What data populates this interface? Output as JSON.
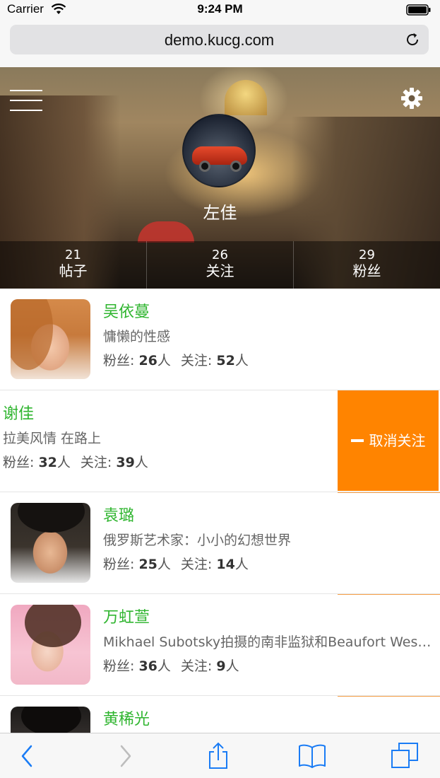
{
  "status_bar": {
    "carrier": "Carrier",
    "time": "9:24 PM"
  },
  "browser": {
    "url": "demo.kucg.com"
  },
  "profile": {
    "name": "左佳",
    "stats": [
      {
        "count": "21",
        "label": "帖子"
      },
      {
        "count": "26",
        "label": "关注"
      },
      {
        "count": "29",
        "label": "粉丝"
      }
    ]
  },
  "labels": {
    "fans": "粉丝:",
    "following": "关注:",
    "unit": "人",
    "unfollow": "取消关注"
  },
  "users": [
    {
      "name": "吴依蔓",
      "bio": "慵懒的性感",
      "fans": "26",
      "following": "52"
    },
    {
      "name": "谢佳",
      "bio": "拉美风情 在路上",
      "fans": "32",
      "following": "39"
    },
    {
      "name": "袁璐",
      "bio": "俄罗斯艺术家：小小的幻想世界",
      "fans": "25",
      "following": "14"
    },
    {
      "name": "万虹萱",
      "bio": "Mikhael Subotsky拍摄的南非监狱和Beaufort West小镇",
      "fans": "36",
      "following": "9"
    },
    {
      "name": "黄稀光"
    }
  ],
  "colors": {
    "accent_orange": "#ff8400",
    "name_green": "#2fb52f",
    "ios_blue": "#1a7cf5"
  },
  "icons": [
    "wifi-icon",
    "battery-icon",
    "reload-icon",
    "menu-icon",
    "gear-icon",
    "minus-icon",
    "back-icon",
    "forward-icon",
    "share-icon",
    "bookmarks-icon",
    "tabs-icon"
  ]
}
